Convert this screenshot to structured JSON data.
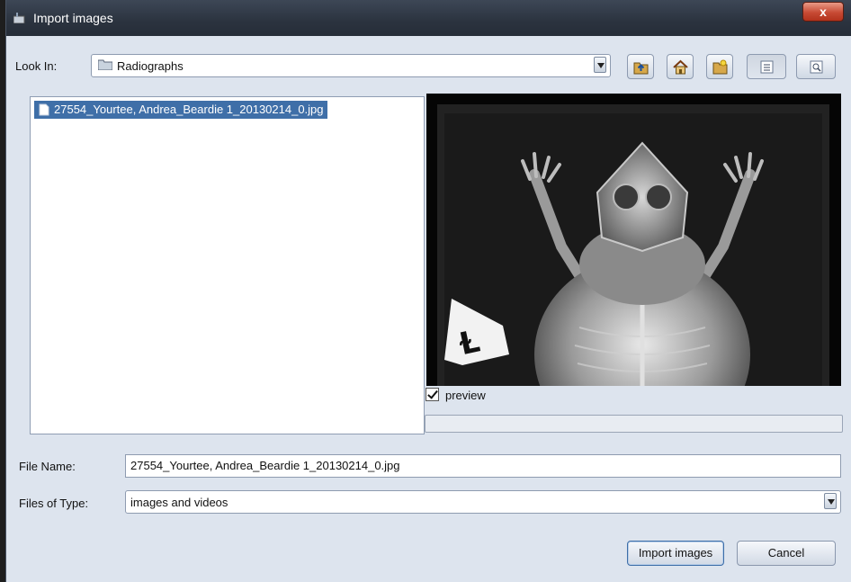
{
  "window": {
    "title": "Import images",
    "close_glyph": "x"
  },
  "toolbar": {
    "look_in_label": "Look In:",
    "look_in_value": "Radiographs",
    "buttons": [
      "up-folder-icon",
      "home-icon",
      "new-folder-icon",
      "list-view-icon",
      "details-view-icon"
    ]
  },
  "file_list": {
    "items": [
      {
        "name": "27554_Yourtee, Andrea_Beardie 1_20130214_0.jpg",
        "selected": true
      }
    ]
  },
  "preview": {
    "checkbox_label": "preview",
    "checked": true,
    "marker_text": "Ɫ"
  },
  "form": {
    "file_name_label": "File Name:",
    "file_name_value": "27554_Yourtee, Andrea_Beardie 1_20130214_0.jpg",
    "file_type_label": "Files of Type:",
    "file_type_value": "images and videos"
  },
  "actions": {
    "import_label": "Import images",
    "cancel_label": "Cancel"
  },
  "colors": {
    "selection": "#3f6fa8",
    "dialog_bg": "#dde4ee",
    "titlebar": "#2b333f"
  }
}
